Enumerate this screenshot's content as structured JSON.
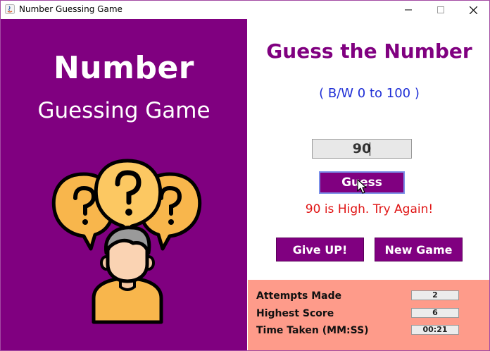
{
  "window": {
    "title": "Number Guessing Game",
    "minimize_glyph": "—",
    "maximize_glyph": "☐",
    "close_glyph": "✕"
  },
  "left": {
    "title_line1": "Number",
    "title_line2": "Guessing Game",
    "background_color": "#800080"
  },
  "game": {
    "heading": "Guess the Number",
    "range_label": "( B/W 0 to 100 )",
    "guess_value": "90",
    "guess_button": "Guess",
    "result_message": "90 is High. Try Again!",
    "give_up_button": "Give UP!",
    "new_game_button": "New Game"
  },
  "stats": {
    "attempts_label": "Attempts Made",
    "attempts_value": "2",
    "highest_label": "Highest Score",
    "highest_value": "6",
    "time_label": "Time Taken (MM:SS)",
    "time_value": "00:21"
  },
  "colors": {
    "accent": "#800080",
    "range_text": "#1f2fd6",
    "result_text": "#e01515",
    "stats_background": "#fe9b8a"
  }
}
